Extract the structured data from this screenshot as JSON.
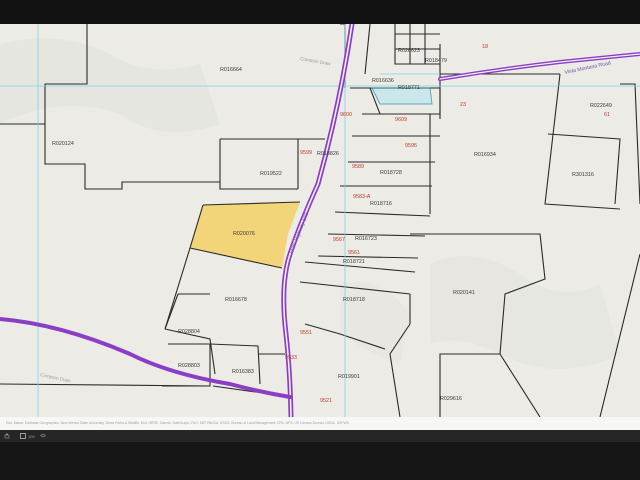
{
  "map": {
    "parcels": [
      {
        "id": "R016664"
      },
      {
        "id": "R020124"
      },
      {
        "id": "R019522"
      },
      {
        "id": "R018826"
      },
      {
        "id": "R018728"
      },
      {
        "id": "R018716"
      },
      {
        "id": "R016723"
      },
      {
        "id": "R018721"
      },
      {
        "id": "R018718"
      },
      {
        "id": "R020076",
        "highlighted": true
      },
      {
        "id": "R016678"
      },
      {
        "id": "R028804"
      },
      {
        "id": "R028803"
      },
      {
        "id": "R016383"
      },
      {
        "id": "R019901"
      },
      {
        "id": "R029616"
      },
      {
        "id": "R020141"
      },
      {
        "id": "R016934"
      },
      {
        "id": "R301316"
      },
      {
        "id": "R022649"
      },
      {
        "id": "R026623"
      },
      {
        "id": "R018479"
      },
      {
        "id": "R016636"
      },
      {
        "id": "R018771"
      }
    ],
    "addresses": [
      "9599",
      "9600",
      "9609",
      "9595",
      "9589",
      "9583-A",
      "9567",
      "9561",
      "9551",
      "9533",
      "9521",
      "18",
      "23",
      "61"
    ],
    "roads": [
      "State Highway 133",
      "Vista Montana Road",
      "Compton Draw",
      "Compton Draw"
    ],
    "highlight_color": "#f1d36f",
    "parcel_line_color": "#2a2a2a",
    "road_color": "#8a3ec4",
    "grid_color": "#7ed3e6"
  },
  "attribution": "Esri, Maxar, Earthstar Geographics, New Mexico State University, Texas Parks & Wildlife, Esri, HERE, Garmin, SafeGraph, FAO, METI/NASA, USGS, Bureau of Land Management, EPA, NPS, US Census Bureau, USDA, USFWS",
  "toolbar": {
    "zoom_value": "100",
    "icons": [
      "print-icon",
      "zoom-select-icon",
      "layers-icon"
    ]
  }
}
